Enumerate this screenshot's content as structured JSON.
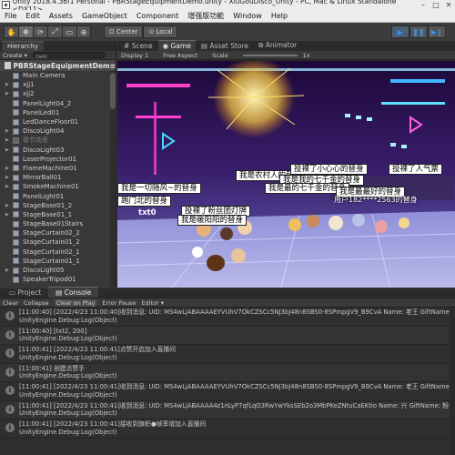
{
  "window": {
    "title": "Unity 2018.4.36f1 Personal - PBRStageEquipmentDemo.unity - XiuGouDisco_Unity - PC, Mac & Linux Standalone <DX11>",
    "minimize": "–",
    "maximize": "□",
    "close": "✕"
  },
  "menu": [
    "File",
    "Edit",
    "Assets",
    "GameObject",
    "Component",
    "增强版功能",
    "Window",
    "Help"
  ],
  "toolbar": {
    "pivot_center": "Center",
    "pivot_local": "Local"
  },
  "hierarchy": {
    "tab": "Hierarchy",
    "create": "Create ▾",
    "search_prefix": "Q▾All",
    "scene_name": "PBRStageEquipmentDem≡",
    "items": [
      {
        "label": "Main Camera",
        "dim": false,
        "arrow": false
      },
      {
        "label": "xjj1",
        "dim": false,
        "arrow": true
      },
      {
        "label": "xjj2",
        "dim": false,
        "arrow": true
      },
      {
        "label": "PanelLight04_2",
        "dim": false,
        "arrow": false
      },
      {
        "label": "PanelLed01",
        "dim": false,
        "arrow": false
      },
      {
        "label": "LedDanceFloor01",
        "dim": false,
        "arrow": false
      },
      {
        "label": "DiscoLight04",
        "dim": false,
        "arrow": true
      },
      {
        "label": "春节场景",
        "dim": true,
        "arrow": true
      },
      {
        "label": "DiscoLight03",
        "dim": false,
        "arrow": true
      },
      {
        "label": "LaserProjector01",
        "dim": false,
        "arrow": false
      },
      {
        "label": "FlameMachine01",
        "dim": false,
        "arrow": true
      },
      {
        "label": "MirrorBall01",
        "dim": false,
        "arrow": true
      },
      {
        "label": "SmokeMachine01",
        "dim": false,
        "arrow": true
      },
      {
        "label": "PanelLight01",
        "dim": false,
        "arrow": false
      },
      {
        "label": "StageBase01_2",
        "dim": false,
        "arrow": true
      },
      {
        "label": "StageBase01_1",
        "dim": false,
        "arrow": true
      },
      {
        "label": "StageBase01Stairs",
        "dim": false,
        "arrow": false
      },
      {
        "label": "StageCurtain02_2",
        "dim": false,
        "arrow": false
      },
      {
        "label": "StageCurtain01_2",
        "dim": false,
        "arrow": false
      },
      {
        "label": "StageCurtain02_1",
        "dim": false,
        "arrow": false
      },
      {
        "label": "StageCurtain01_1",
        "dim": false,
        "arrow": false
      },
      {
        "label": "DiscoLight05",
        "dim": false,
        "arrow": true
      },
      {
        "label": "SpeakerTripod01",
        "dim": false,
        "arrow": false
      }
    ]
  },
  "game": {
    "tabs": [
      "Scene",
      "Game",
      "Asset Store",
      "Animator"
    ],
    "active_tab": "Game",
    "display": "Display 1",
    "aspect": "Free Aspect",
    "scale_label": "Scale",
    "scale_value": "1x",
    "bubbles": [
      "我是农村人的替身",
      "投裸了小心心的替身",
      "投裸了人气票",
      "我是一切随风~的替身",
      "我是我的七千金的替身",
      "我是最的七千金的替身",
      "我是最最好的替身",
      "跑门北的替身",
      "投裸了粉丝团灯牌",
      "我是暖阳阳的替身",
      "txt0"
    ],
    "banner": "用户182****2563的替身"
  },
  "console": {
    "tabs": [
      "Project",
      "Console"
    ],
    "active_tab": "Console",
    "toolbar": [
      "Clear",
      "Collapse",
      "Clear on Play",
      "Error Pause",
      "Editor ▾"
    ],
    "logs": [
      {
        "line1": "[11:00:40] [2022/4/23 11:00:40]收到消息: UID: MS4wLjABAAAAEYVUhV7OkCZSCc5NJ3bJ48n8SBS0-8SPmpgV9_B9CvA  Name: 老王  GiftName: 小心心",
        "line2": "UnityEngine.Debug:Log(Object)"
      },
      {
        "line1": "[11:00:40] [txt2, 200]",
        "line2": "UnityEngine.Debug:Log(Object)"
      },
      {
        "line1": "[11:00:41] [2022/4/23 11:00:41]点赞开启加入直播间",
        "line2": "UnityEngine.Debug:Log(Object)"
      },
      {
        "line1": "[11:00:41] 创建点赞手",
        "line2": "UnityEngine.Debug:Log(Object)"
      },
      {
        "line1": "[11:00:41] [2022/4/23 11:00:41]收到消息: UID: MS4wLjABAAAAEYVUhV7OkCZSCc5NJ3bJ48n8SBS0-8SPmpgV9_B9CvA  Name: 老王  GiftName: 小心心",
        "line2": "UnityEngine.Debug:Log(Object)"
      },
      {
        "line1": "[11:00:41] [2022/4/23 11:00:41]收到消息: UID: MS4wLjABAAAA4z1nLyP7qfLqO3RwYwYksSEb2o3MbPKeZNtuCaEKtio  Name: 兴  GiftName: 粉丝团灯牌",
        "line2": "UnityEngine.Debug:Log(Object)"
      },
      {
        "line1": "[11:00:41] [2022/4/23 11:00:41]接收到旗帜●帧率增加入直播间",
        "line2": "UnityEngine.Debug:Log(Object)"
      }
    ]
  }
}
